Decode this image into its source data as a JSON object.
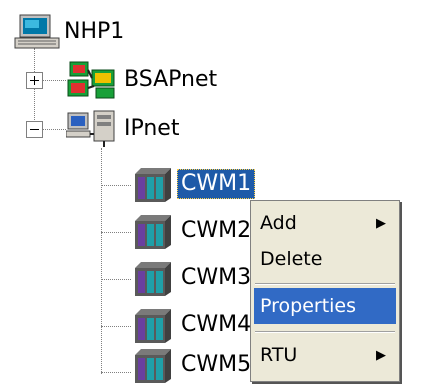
{
  "tree": {
    "root": {
      "label": "NHP1"
    },
    "bsapnet": {
      "label": "BSAPnet"
    },
    "ipnet": {
      "label": "IPnet"
    },
    "children": [
      {
        "label": "CWM1",
        "selected": true
      },
      {
        "label": "CWM2"
      },
      {
        "label": "CWM3"
      },
      {
        "label": "CWM4"
      },
      {
        "label": "CWM5"
      }
    ]
  },
  "context_menu": {
    "items": [
      {
        "label": "Add",
        "submenu": true
      },
      {
        "label": "Delete"
      },
      {
        "label": "Properties",
        "highlighted": true
      },
      {
        "label": "RTU",
        "submenu": true
      }
    ],
    "submenu_arrow": "▶"
  },
  "colors": {
    "selection": "#1e5aa8",
    "menu_highlight": "#316ac5",
    "menu_background": "#ece9d8"
  }
}
